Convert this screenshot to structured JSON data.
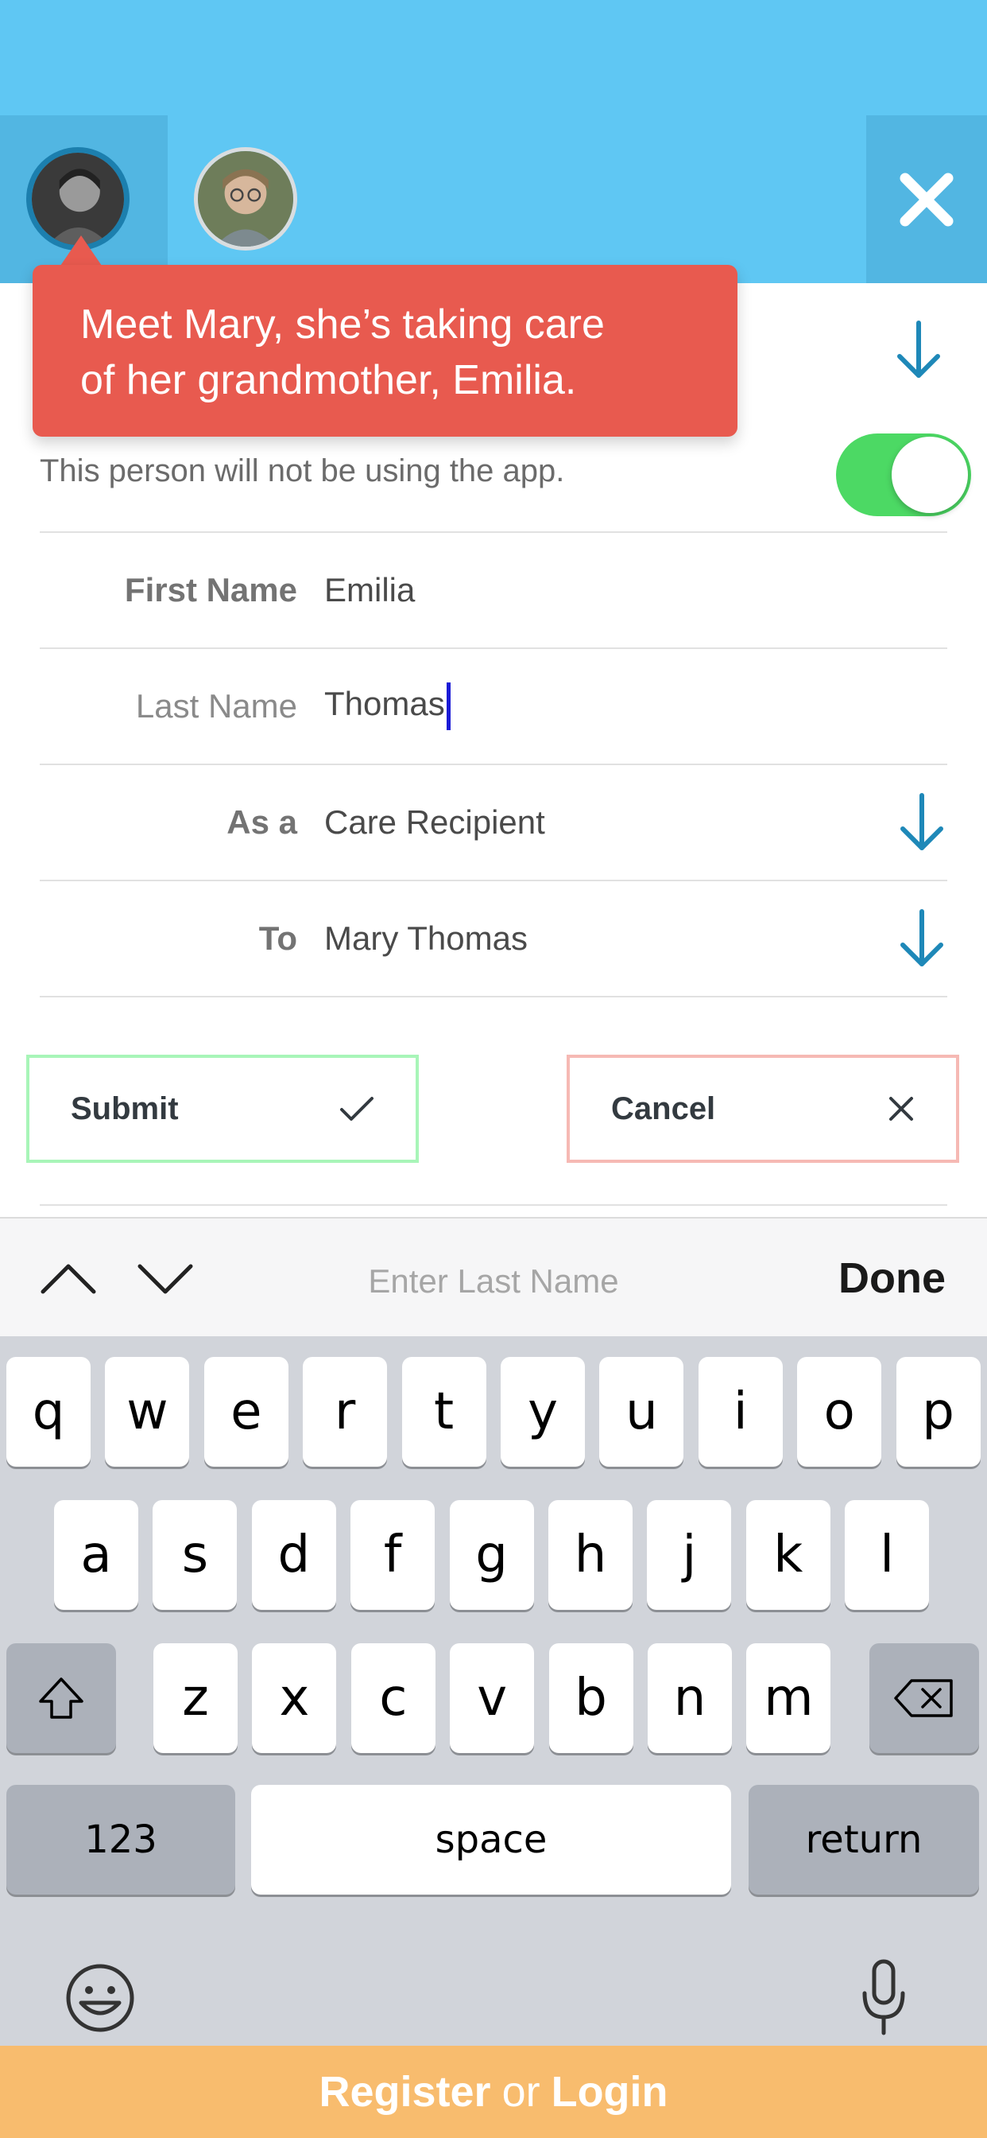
{
  "header": {
    "avatars": [
      {
        "name": "mary-avatar",
        "active": true
      },
      {
        "name": "emilia-avatar",
        "active": false
      }
    ],
    "close_icon": "close-icon"
  },
  "tooltip": {
    "line1": "Meet Mary, she’s taking care",
    "line2": "of her grandmother, Emilia."
  },
  "form": {
    "toggle_text": "This person will not be using the app.",
    "toggle_on": true,
    "rows": [
      {
        "label": "First Name",
        "value": "Emilia",
        "has_dropdown": false
      },
      {
        "label": "Last Name",
        "value": "Thomas",
        "has_dropdown": false
      },
      {
        "label": "As a",
        "value": "Care Recipient",
        "has_dropdown": true
      },
      {
        "label": "To",
        "value": "Mary Thomas",
        "has_dropdown": true
      }
    ],
    "submit_label": "Submit",
    "cancel_label": "Cancel"
  },
  "keyboard": {
    "placeholder": "Enter Last Name",
    "done_label": "Done",
    "row1": [
      "q",
      "w",
      "e",
      "r",
      "t",
      "y",
      "u",
      "i",
      "o",
      "p"
    ],
    "row2": [
      "a",
      "s",
      "d",
      "f",
      "g",
      "h",
      "j",
      "k",
      "l"
    ],
    "row3": [
      "z",
      "x",
      "c",
      "v",
      "b",
      "n",
      "m"
    ],
    "numbers_label": "123",
    "space_label": "space",
    "return_label": "return"
  },
  "footer": {
    "register": "Register",
    "or": "or",
    "login": "Login"
  },
  "colors": {
    "header": "#5fc7f3",
    "tooltip": "#e85a4f",
    "toggle": "#4cd964",
    "footer": "#f8bc6e",
    "accent_arrow": "#1e88b8"
  }
}
